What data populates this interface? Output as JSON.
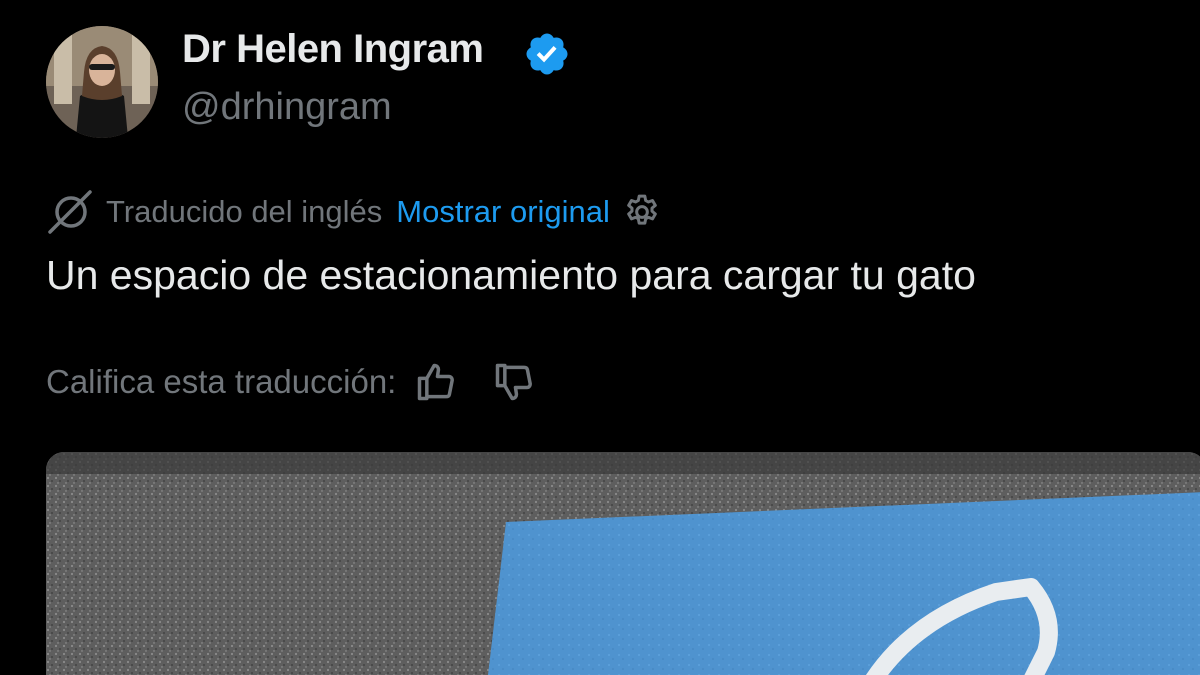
{
  "author": {
    "display_name": "Dr Helen Ingram",
    "handle": "@drhingram",
    "verified": true,
    "avatar_icon": "profile-photo"
  },
  "translation": {
    "translated_from": "Traducido del inglés",
    "show_original": "Mostrar original",
    "icon": "translate-icon",
    "settings_icon": "gear-icon"
  },
  "tweet": {
    "text": "Un espacio de estacionamiento para cargar tu gato"
  },
  "rating": {
    "label": "Califica esta traducción:",
    "thumbs_up_icon": "thumbs-up-icon",
    "thumbs_down_icon": "thumbs-down-icon"
  },
  "media": {
    "type": "photo"
  },
  "colors": {
    "background": "#000000",
    "primary_text": "#e7e9ea",
    "secondary_text": "#71767b",
    "accent": "#1d9bf0"
  }
}
